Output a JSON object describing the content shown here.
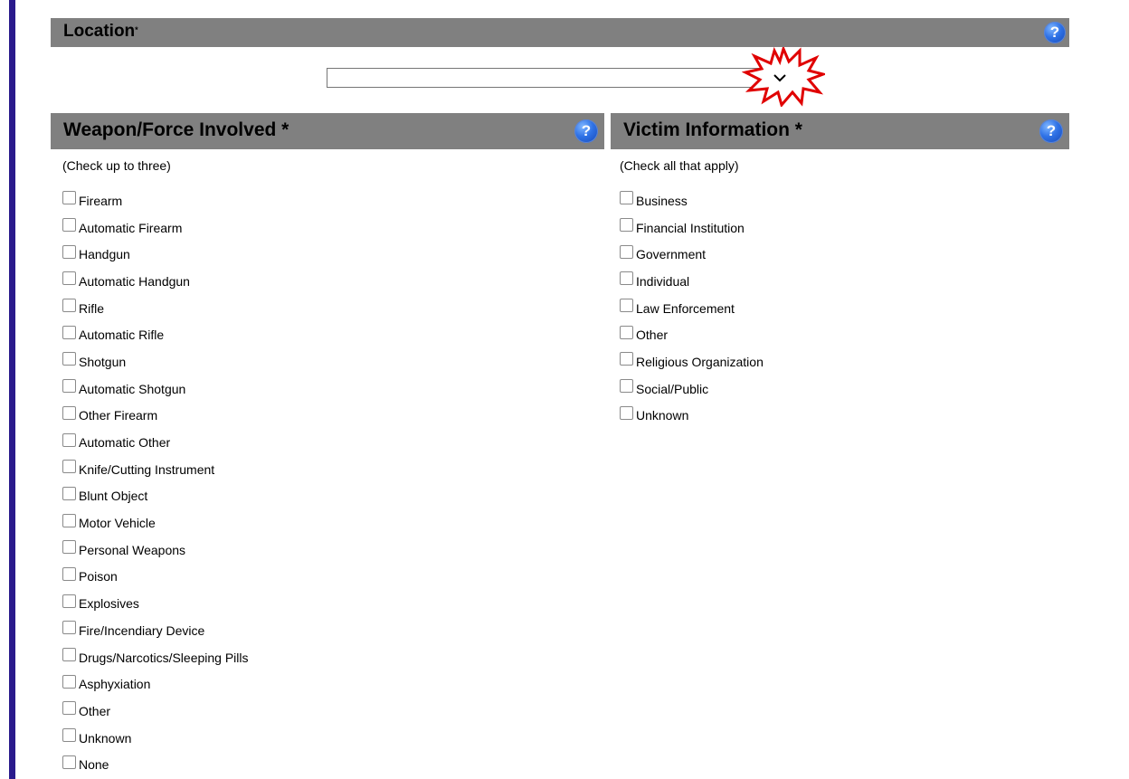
{
  "location": {
    "title": "Location",
    "required_mark": "*",
    "help": "?",
    "select_value": ""
  },
  "weapon": {
    "title": "Weapon/Force Involved *",
    "help": "?",
    "instruction": "(Check up to three)",
    "options": [
      "Firearm",
      "Automatic Firearm",
      "Handgun",
      "Automatic Handgun",
      "Rifle",
      "Automatic Rifle",
      "Shotgun",
      "Automatic Shotgun",
      "Other Firearm",
      "Automatic Other",
      "Knife/Cutting Instrument",
      "Blunt Object",
      "Motor Vehicle",
      "Personal Weapons",
      "Poison",
      "Explosives",
      "Fire/Incendiary Device",
      "Drugs/Narcotics/Sleeping Pills",
      "Asphyxiation",
      "Other",
      "Unknown",
      "None"
    ]
  },
  "victim": {
    "title": "Victim Information *",
    "help": "?",
    "instruction": "(Check all that apply)",
    "options": [
      "Business",
      "Financial Institution",
      "Government",
      "Individual",
      "Law Enforcement",
      "Other",
      "Religious Organization",
      "Social/Public",
      "Unknown"
    ]
  },
  "colors": {
    "header_bar": "#808080",
    "left_rule": "#2a1a8c",
    "help_icon": "#2f72e6",
    "highlight_burst": "#e00000"
  },
  "icons": {
    "help": "question-circle-icon",
    "dropdown": "chevron-down-icon",
    "highlight": "starburst-highlight"
  }
}
